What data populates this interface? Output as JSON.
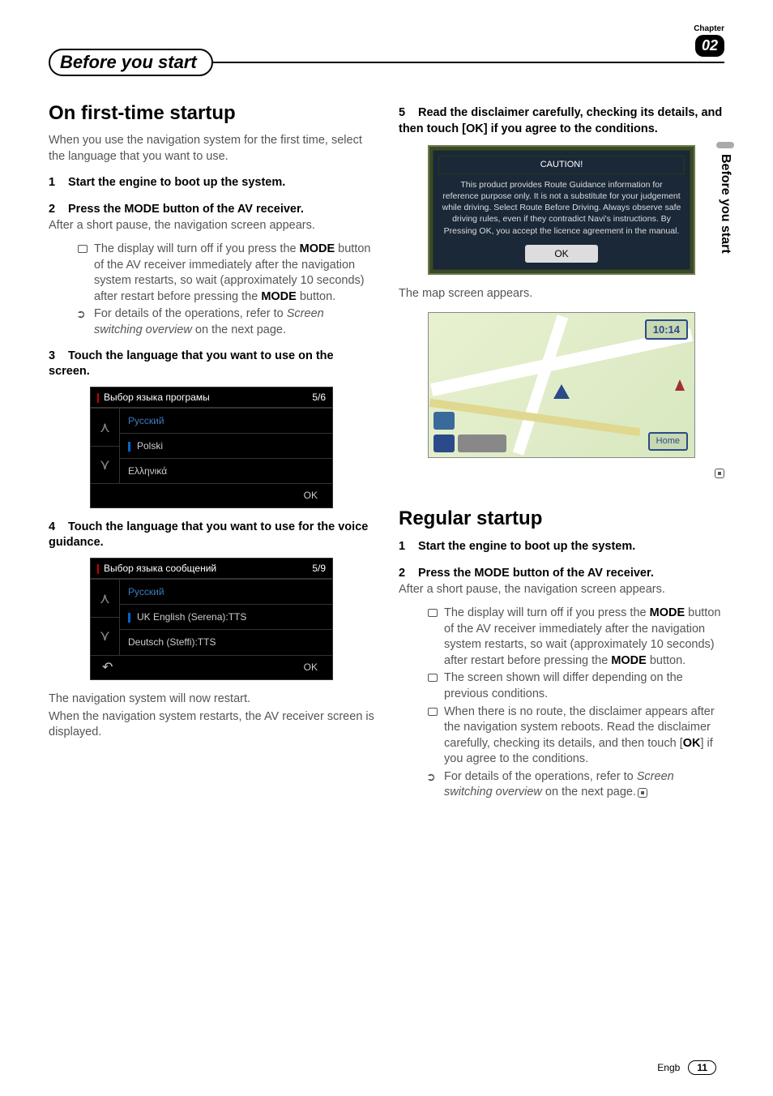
{
  "chapter": {
    "label": "Chapter",
    "number": "02"
  },
  "header": {
    "title": "Before you start"
  },
  "side_tab": "Before you start",
  "left": {
    "h2": "On first-time startup",
    "intro": "When you use the navigation system for the first time, select the language that you want to use.",
    "step1": {
      "num": "1",
      "text": "Start the engine to boot up the system."
    },
    "step2": {
      "num": "2",
      "text": "Press the MODE button of the AV receiver."
    },
    "step2_sub": "After a short pause, the navigation screen appears.",
    "step2_note_a": "The display will turn off if you press the ",
    "step2_note_b": " button of the AV receiver immediately after the navigation system restarts, so wait (approximately 10 seconds) after restart before pressing the ",
    "step2_note_c": " button.",
    "mode": "MODE",
    "step2_ref_a": "For details of the operations, refer to ",
    "step2_ref_link": "Screen switching overview",
    "step2_ref_b": " on the next page.",
    "step3": {
      "num": "3",
      "text": "Touch the language that you want to use on the screen."
    },
    "shot1": {
      "title": "Выбор языка програмы",
      "count": "5/6",
      "items": [
        "Русский",
        "Polski",
        "Ελληνικά"
      ],
      "ok": "OK"
    },
    "step4": {
      "num": "4",
      "text": "Touch the language that you want to use for the voice guidance."
    },
    "shot2": {
      "title": "Выбор языка сообщений",
      "count": "5/9",
      "items": [
        "Русский",
        "UK English (Serena):TTS",
        "Deutsch (Steffi):TTS"
      ],
      "ok": "OK"
    },
    "after4_a": "The navigation system will now restart.",
    "after4_b": "When the navigation system restarts, the AV receiver screen is displayed."
  },
  "right": {
    "step5": {
      "num": "5",
      "text": "Read the disclaimer carefully, checking its details, and then touch [OK] if you agree to the conditions."
    },
    "caution": {
      "title": "CAUTION!",
      "body": "This product provides Route Guidance information for reference purpose only. It is not a substitute for your judgement while driving. Select Route Before Driving. Always observe safe driving rules, even if they contradict Navi's instructions. By Pressing OK, you accept the licence agreement in the manual.",
      "ok": "OK"
    },
    "map_caption": "The map screen appears.",
    "map": {
      "time": "10:14",
      "home": "Home"
    },
    "h2": "Regular startup",
    "step1": {
      "num": "1",
      "text": "Start the engine to boot up the system."
    },
    "step2": {
      "num": "2",
      "text": "Press the MODE button of the AV receiver."
    },
    "step2_sub": "After a short pause, the navigation screen appears.",
    "note1_a": "The display will turn off if you press the ",
    "note1_b": " button of the AV receiver immediately after the navigation system restarts, so wait (approximately 10 seconds) after restart before pressing the ",
    "note1_c": " button.",
    "note2": "The screen shown will differ depending on the previous conditions.",
    "note3_a": "When there is no route, the disclaimer appears after the navigation system reboots. Read the disclaimer carefully, checking its details, and then touch [",
    "note3_ok": "OK",
    "note3_b": "] if you agree to the conditions.",
    "ref_a": "For details of the operations, refer to ",
    "ref_link": "Screen switching overview",
    "ref_b": " on the next page."
  },
  "footer": {
    "lang": "Engb",
    "page": "11"
  }
}
